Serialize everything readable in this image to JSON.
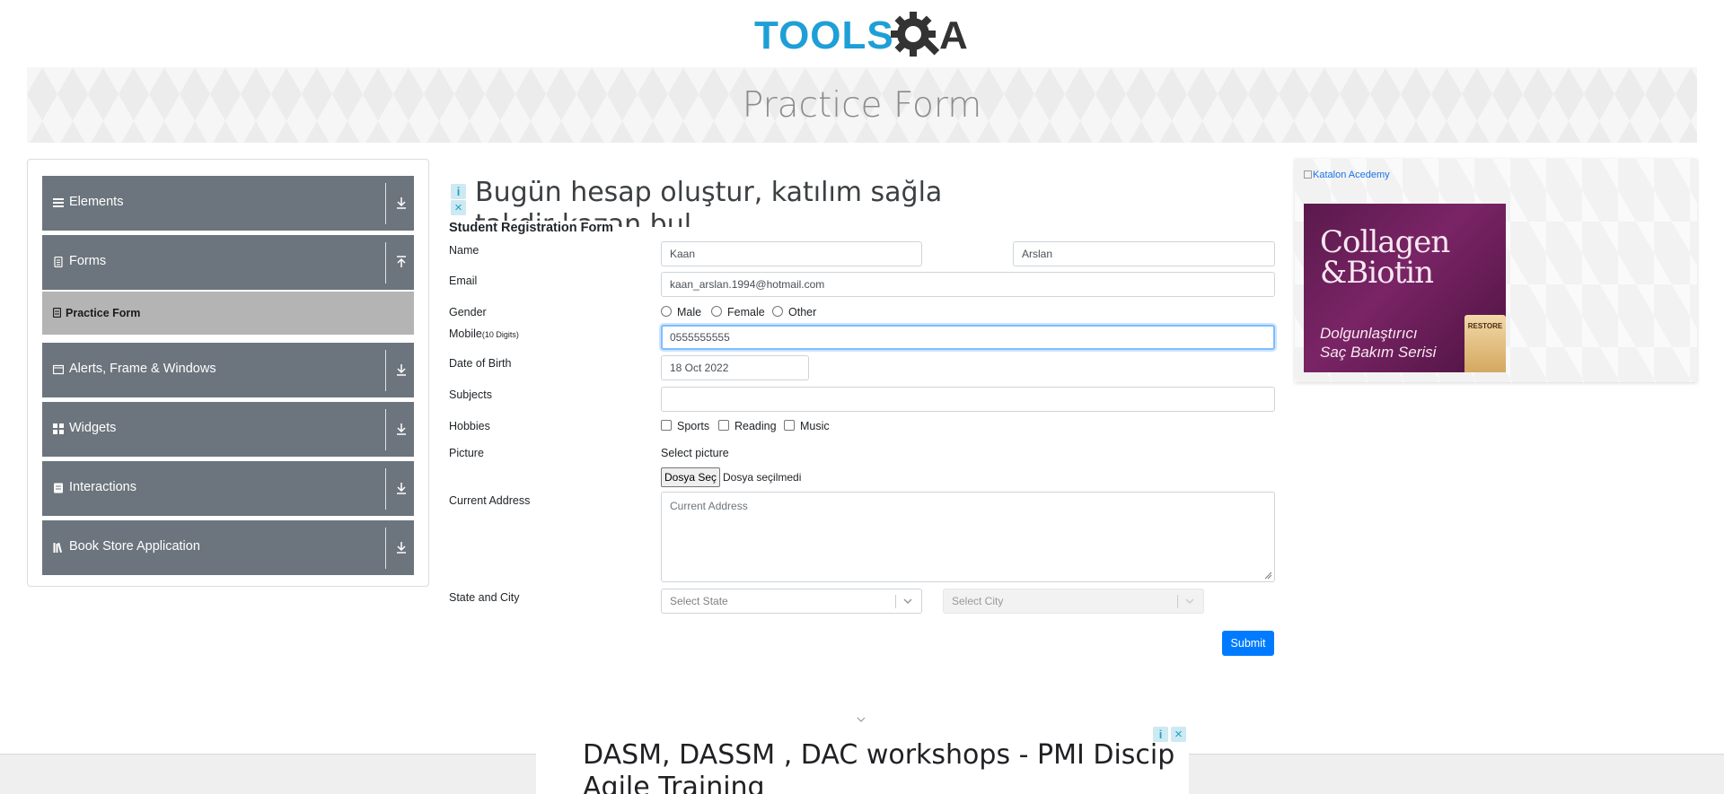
{
  "header": {
    "logo_text": "TOOLSQA",
    "page_title": "Practice Form"
  },
  "sidebar": {
    "groups": [
      {
        "label": "Elements",
        "icon": "menu-icon",
        "expanded": false
      },
      {
        "label": "Forms",
        "icon": "document-icon",
        "expanded": true
      },
      {
        "label": "Alerts, Frame & Windows",
        "icon": "window-icon",
        "expanded": false
      },
      {
        "label": "Widgets",
        "icon": "grid-icon",
        "expanded": false
      },
      {
        "label": "Interactions",
        "icon": "interaction-icon",
        "expanded": false
      },
      {
        "label": "Book Store Application",
        "icon": "books-icon",
        "expanded": false
      }
    ],
    "active_item": "Practice Form"
  },
  "top_ad": {
    "line1": "Bugün hesap oluştur, katılım sağla ve",
    "line2": "takdir kazan bul"
  },
  "form": {
    "title": "Student Registration Form",
    "name_label": "Name",
    "first_name": "Kaan",
    "last_name": "Arslan",
    "email_label": "Email",
    "email": "kaan_arslan.1994@hotmail.com",
    "gender_label": "Gender",
    "gender_options": [
      "Male",
      "Female",
      "Other"
    ],
    "mobile_label": "Mobile",
    "mobile_hint": "(10 Digits)",
    "mobile": "0555555555",
    "dob_label": "Date of Birth",
    "dob": "18 Oct 2022",
    "subjects_label": "Subjects",
    "hobbies_label": "Hobbies",
    "hobbies": [
      "Sports",
      "Reading",
      "Music"
    ],
    "picture_label": "Picture",
    "select_picture": "Select picture",
    "file_button": "Dosya Seç",
    "file_status": "Dosya seçilmedi",
    "address_label": "Current Address",
    "address_placeholder": "Current Address",
    "state_city_label": "State and City",
    "state_placeholder": "Select State",
    "city_placeholder": "Select City",
    "submit": "Submit"
  },
  "right_ad": {
    "alt_text": "Katalon Acedemy",
    "title_line1": "Collagen",
    "title_line2": "&Biotin",
    "sub_line1": "Dolgunlaştırıcı",
    "sub_line2": "Saç Bakım Serisi",
    "bottle_brand": "RESTORE"
  },
  "bottom_ad": {
    "line1": "DASM, DASSM , DAC workshops - PMI Discip",
    "line2": "Agile Training"
  },
  "colors": {
    "sidebar_group": "#6c757d",
    "active_item_bg": "#b4b4b4",
    "submit": "#007bff",
    "logo_blue": "#1e9fd6",
    "logo_dark": "#333333"
  }
}
